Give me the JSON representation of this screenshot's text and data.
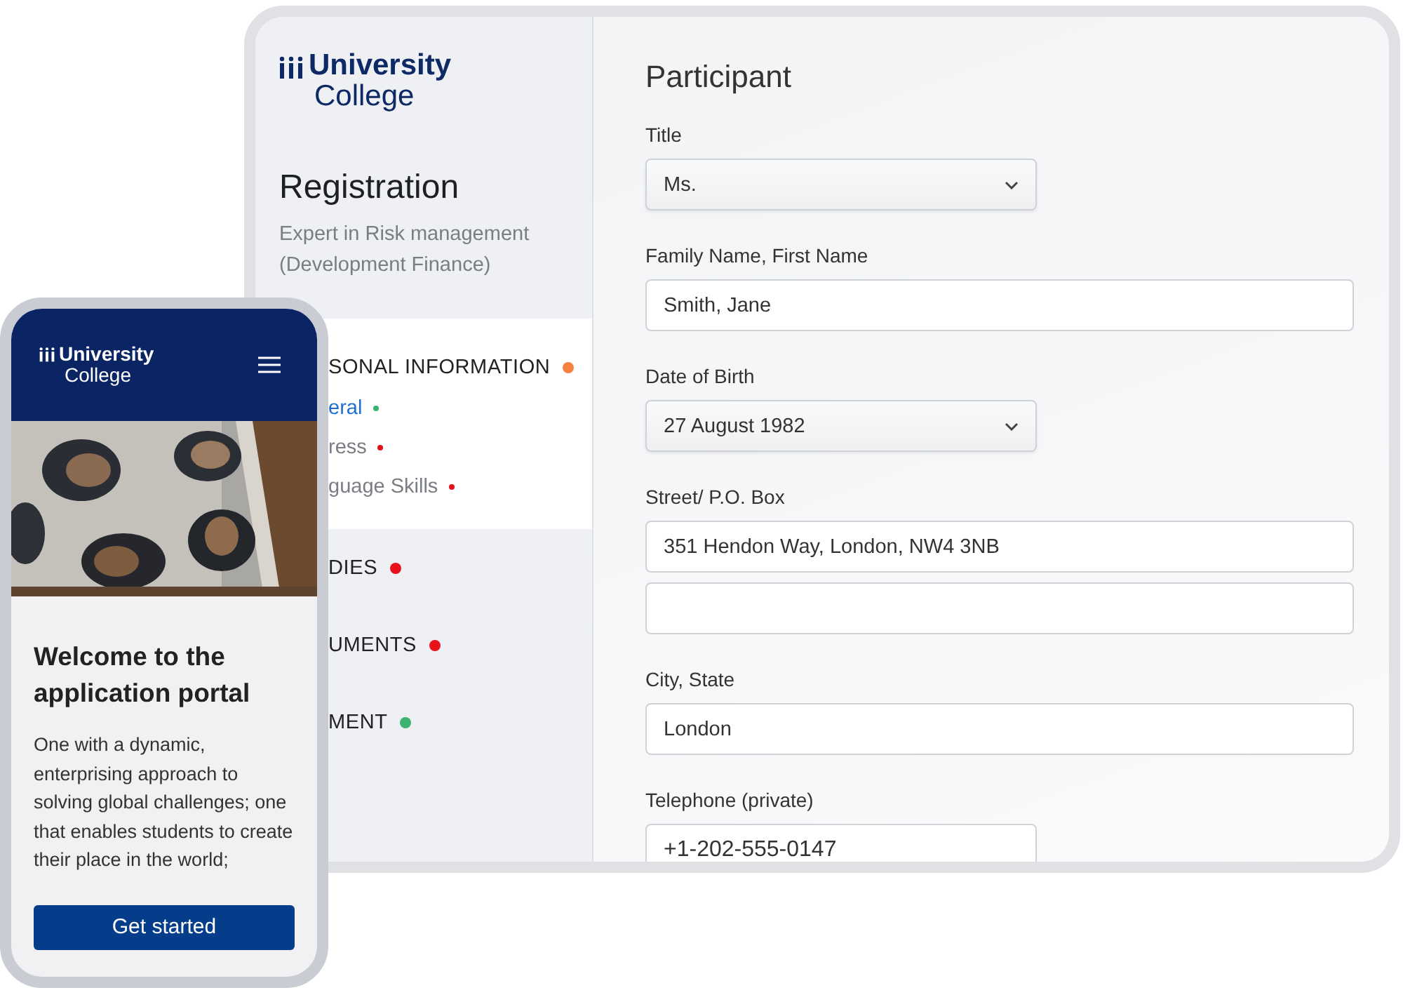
{
  "tablet": {
    "logo": {
      "line1": "University",
      "line2": "College"
    },
    "sidebar": {
      "title": "Registration",
      "subtitle": "Expert in Risk management (Development Finance)",
      "sections": [
        {
          "label": "SONAL INFORMATION",
          "color": "#f5823f",
          "expanded": true,
          "children": [
            {
              "label": "eral",
              "color": "#3cb371",
              "selected": true
            },
            {
              "label": "ress",
              "color": "#e0111b",
              "selected": false
            },
            {
              "label": "guage Skills",
              "color": "#e0111b",
              "selected": false
            }
          ]
        },
        {
          "label": "DIES",
          "color": "#e8121b",
          "expanded": false
        },
        {
          "label": "UMENTS",
          "color": "#e8121b",
          "expanded": false
        },
        {
          "label": "MENT",
          "color": "#3cb371",
          "expanded": false
        }
      ]
    },
    "form": {
      "title": "Participant",
      "fields": [
        {
          "label": "Title",
          "kind": "select",
          "value": "Ms."
        },
        {
          "label": "Family Name, First Name",
          "kind": "input",
          "value": "Smith, Jane"
        },
        {
          "label": "Date of Birth",
          "kind": "select",
          "value": "27 August 1982"
        },
        {
          "label": "Street/ P.O. Box",
          "kind": "input",
          "value": "351 Hendon Way, London, NW4 3NB"
        },
        {
          "kind": "input"
        },
        {
          "label": "City, State",
          "kind": "input",
          "value": "London"
        },
        {
          "label": "Telephone (private)",
          "kind": "short-input",
          "value": "+1-202-555-0147"
        }
      ]
    }
  },
  "phone": {
    "logo": {
      "line1": "University",
      "line2": "College"
    },
    "heading": "Welcome to the application portal",
    "text": "One with a dynamic, enterprising approach to solving global challenges; one that enables students to create their place in the world;",
    "button": "Get started"
  }
}
